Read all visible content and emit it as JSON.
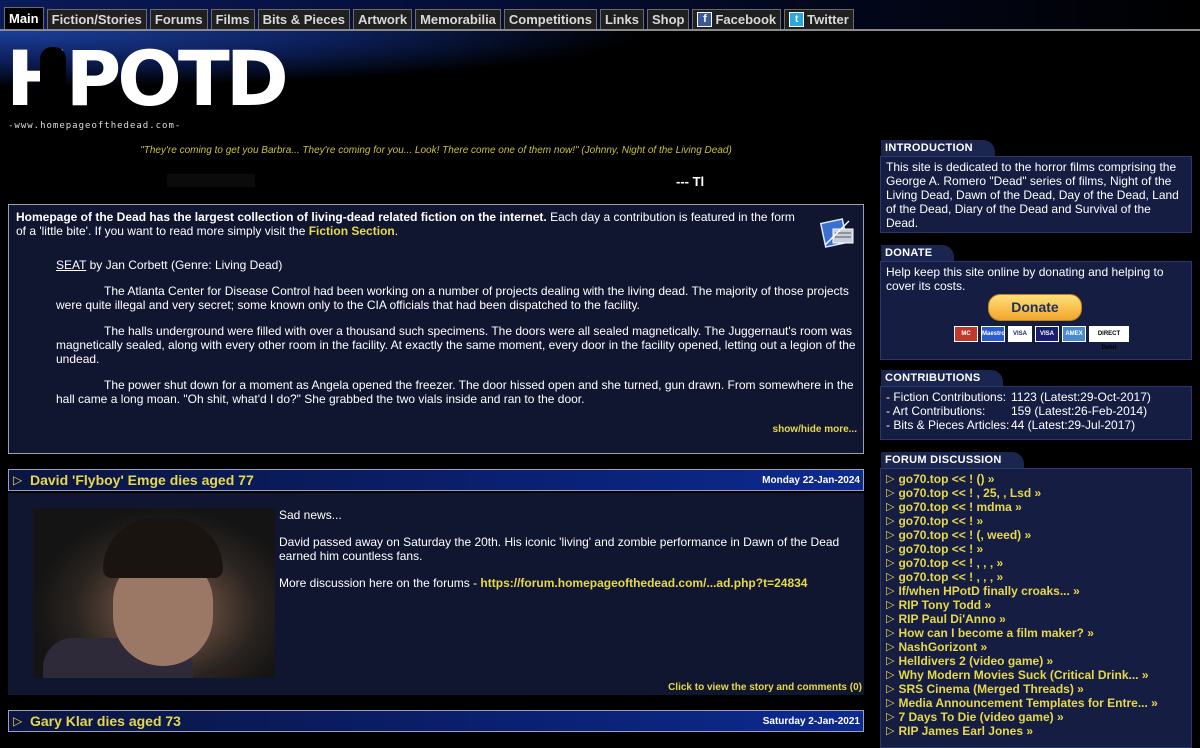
{
  "nav": {
    "tabs": [
      "Main",
      "Fiction/Stories",
      "Forums",
      "Films",
      "Bits & Pieces",
      "Artwork",
      "Memorabilia",
      "Competitions",
      "Links",
      "Shop",
      "Facebook",
      "Twitter"
    ]
  },
  "header": {
    "logo_text": "HPOTD",
    "logo_url": "-www.homepageofthedead.com-",
    "quote": "\"They're coming to get you Barbra... They're coming for you... Look! There come one of them now!\" (Johnny, Night of the Living Dead)",
    "ticker": "--- Tl"
  },
  "feature": {
    "intro_bold": "Homepage of the Dead has the largest collection of living-dead related fiction on the internet.",
    "intro_rest": " Each day a contribution is featured in the form of a 'little bite'. If you want to read more simply visit the ",
    "fiction_link": "Fiction Section",
    "intro_end": ".",
    "story_title": "SEAT",
    "story_byline": " by Jan Corbett (Genre: Living Dead)",
    "paragraphs": [
      "The Atlanta Center for Disease Control had been working on a number of projects dealing with the living dead. The majority of those projects were quite illegal and very secret; some known only to the CIA officials that had been dispatched to the facility.",
      "The halls underground were filled with over a thousand such specimens. The doors were all sealed magnetically. The Juggernaut's room was magnetically sealed, along with every other room in the facility. At exactly the same moment, every door in the facility opened, letting out a legion of the undead.",
      "The power shut down for a moment as Angela opened the freezer. The door hissed open and she turned, gun drawn. From somewhere in the hall came a long moan. \"Oh shit, what'd I do?\" She grabbed the two vials inside and ran to the door."
    ],
    "show_hide": "show/hide more..."
  },
  "news": [
    {
      "title": "David 'Flyboy' Emge dies aged 77",
      "date": "Monday 22-Jan-2024",
      "p1": "Sad news...",
      "p2": "David passed away on Saturday the 20th. His iconic 'living' and zombie performance in Dawn of the Dead earned him countless fans.",
      "p3_prefix": "More discussion here on the forums - ",
      "p3_link": "https://forum.homepageofthedead.com/...ad.php?t=24834",
      "click": "Click to view the story and comments (0)"
    },
    {
      "title": "Gary Klar dies aged 73",
      "date": "Saturday 2-Jan-2021"
    }
  ],
  "sidebar": {
    "intro_head": "INTRODUCTION",
    "intro_text": "This site is dedicated to the horror films comprising the George A. Romero \"Dead\" series of films, Night of the Living Dead, Dawn of the Dead, Day of the Dead, Land of the Dead, Diary of the Dead and Survival of the Dead.",
    "donate_head": "DONATE",
    "donate_text": "Help keep this site online by donating and helping to cover its costs.",
    "donate_button": "Donate",
    "cards": [
      "MC",
      "Maestro",
      "VISA",
      "VISA",
      "AMEX",
      "DIRECT Debit"
    ],
    "contrib_head": "CONTRIBUTIONS",
    "contributions": [
      {
        "label": "- Fiction Contributions:",
        "value": "1123 (Latest:29-Oct-2017)"
      },
      {
        "label": "- Art Contributions:",
        "value": "159 (Latest:26-Feb-2014)"
      },
      {
        "label": "- Bits & Pieces Articles:",
        "value": "44 (Latest:29-Jul-2017)"
      }
    ],
    "forum_head": "FORUM DISCUSSION",
    "forum": [
      "go70.top << ! () »",
      "go70.top << ! , 25, , Lsd »",
      "go70.top << ! mdma »",
      "go70.top << ! »",
      "go70.top << ! (, weed) »",
      "go70.top << ! »",
      "go70.top << ! , , , »",
      "go70.top << ! , , , »",
      "If/when HPotD finally croaks... »",
      "RIP Tony Todd »",
      "RIP Paul Di'Anno »",
      "How can I become a film maker? »",
      "NashGorizont »",
      "Helldivers 2 (video game) »",
      "Why Modern Movies Suck (Critical Drink... »",
      "SRS Cinema (Merged Threads) »",
      "Media Announcement Templates for Entre... »",
      "7 Days To Die (video game) »",
      "RIP James Earl Jones »"
    ]
  },
  "colors": {
    "accent_yellow": "#e6d84a",
    "panel_bg": "#101630",
    "sidebar_bg": "#151d42"
  }
}
